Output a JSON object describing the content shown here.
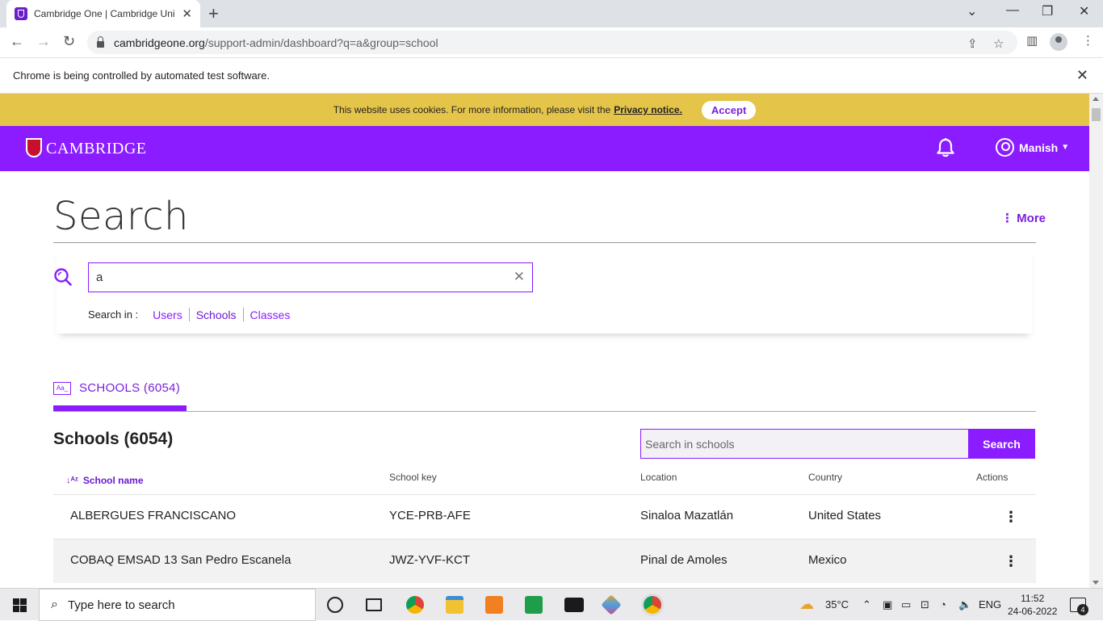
{
  "browser": {
    "tab_title": "Cambridge One | Cambridge Uni",
    "url_host": "cambridgeone.org",
    "url_path": "/support-admin/dashboard?q=a&group=school",
    "automation_notice": "Chrome is being controlled by automated test software."
  },
  "cookie_banner": {
    "text": "This website uses cookies. For more information, please visit the",
    "link": "Privacy notice.",
    "accept_label": "Accept"
  },
  "header": {
    "brand": "CAMBRIDGE",
    "user_name": "Manish",
    "brand_color": "#8a1cff"
  },
  "page": {
    "title": "Search",
    "more_label": "More"
  },
  "search": {
    "query": "a",
    "search_in_label": "Search in :",
    "options": [
      "Users",
      "Schools",
      "Classes"
    ],
    "active_option": "Schools"
  },
  "results": {
    "tab_label": "SCHOOLS (6054)",
    "title": "Schools (6054)",
    "filter_placeholder": "Search in schools",
    "filter_button": "Search",
    "columns": {
      "name": "School name",
      "key": "School key",
      "location": "Location",
      "country": "Country",
      "actions": "Actions"
    },
    "rows": [
      {
        "name": "ALBERGUES FRANCISCANO",
        "key": "YCE-PRB-AFE",
        "location": "Sinaloa Mazatlán",
        "country": "United States"
      },
      {
        "name": "COBAQ EMSAD 13 San Pedro Escanela",
        "key": "JWZ-YVF-KCT",
        "location": "Pinal de Amoles",
        "country": "Mexico"
      }
    ]
  },
  "taskbar": {
    "search_placeholder": "Type here to search",
    "temperature": "35°C",
    "language": "ENG",
    "time": "11:52",
    "date": "24-06-2022",
    "notification_count": "4"
  }
}
